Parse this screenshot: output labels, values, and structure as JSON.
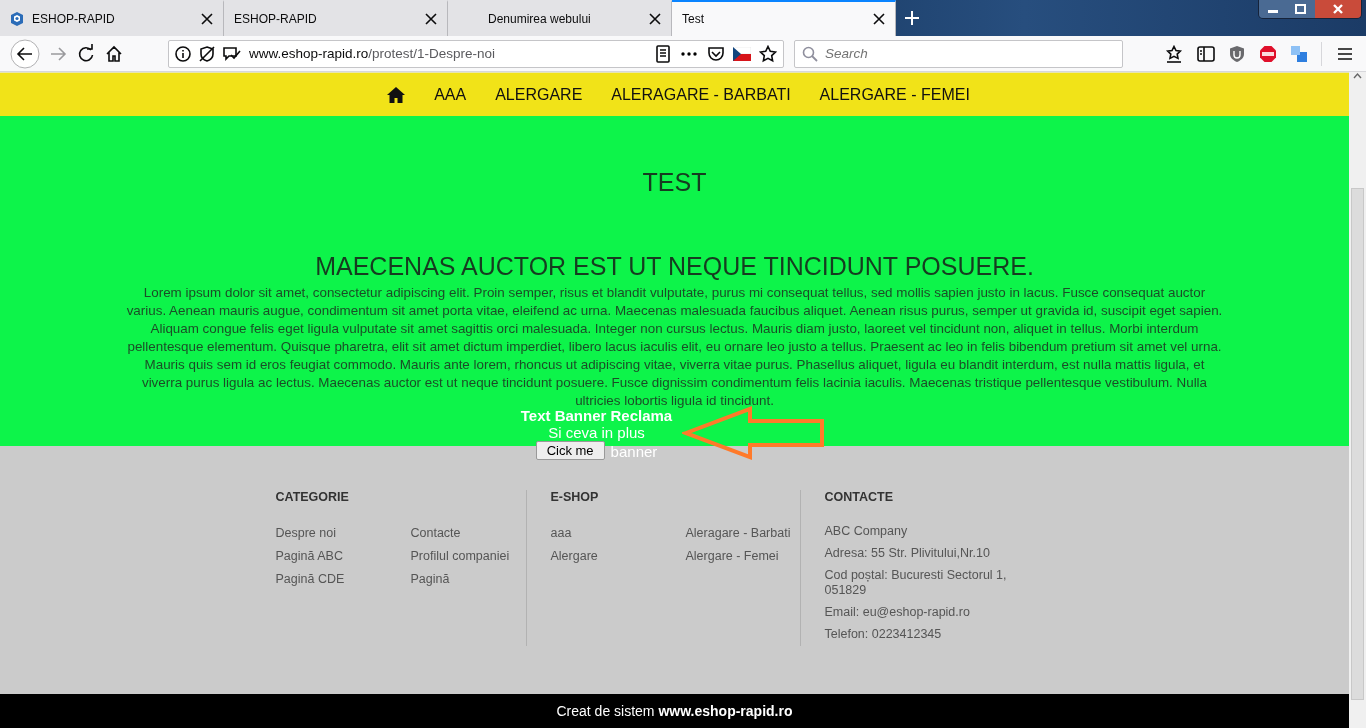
{
  "browser": {
    "tabs": [
      {
        "title": "ESHOP-RAPID",
        "selected": false,
        "favicon": true
      },
      {
        "title": "ESHOP-RAPID",
        "selected": false,
        "favicon": false
      },
      {
        "title": "Denumirea webului",
        "selected": false,
        "favicon": false
      },
      {
        "title": "Test",
        "selected": true,
        "favicon": false
      }
    ],
    "url_host": "www.eshop-rapid.ro",
    "url_path": "/protest/1-Despre-noi",
    "search_placeholder": "Search"
  },
  "nav": {
    "items": [
      "AAA",
      "ALERGARE",
      "ALERAGARE - BARBATI",
      "ALERGARE - FEMEI"
    ]
  },
  "hero": {
    "title": "TEST",
    "heading": "MAECENAS AUCTOR EST UT NEQUE TINCIDUNT POSUERE.",
    "body": "Lorem ipsum dolor sit amet, consectetur adipiscing elit. Proin semper, risus et blandit vulputate, purus mi consequat tellus, sed mollis sapien justo in lacus. Fusce consequat auctor varius. Aenean mauris augue, condimentum sit amet porta vitae, eleifend ac urna. Maecenas malesuada faucibus aliquet. Aenean risus purus, semper ut gravida id, suscipit eget sapien. Aliquam congue felis eget ligula vulputate sit amet sagittis orci malesuada. Integer non cursus lectus. Mauris diam justo, laoreet vel tincidunt non, aliquet in tellus. Morbi interdum pellentesque elementum. Quisque pharetra, elit sit amet dictum imperdiet, libero lacus iaculis elit, eu ornare leo justo a tellus. Praesent ac leo in felis bibendum pretium sit amet vel urna. Mauris quis sem id eros feugiat commodo. Mauris ante lorem, rhoncus ut adipiscing vitae, viverra vitae purus. Phasellus aliquet, ligula eu blandit interdum, est nulla mattis ligula, et viverra purus ligula ac lectus. Maecenas auctor est ut neque tincidunt posuere. Fusce dignissim condimentum felis lacinia iaculis. Maecenas tristique pellentesque vestibulum. Nulla ultricies lobortis ligula id tincidunt.",
    "banner": {
      "title": "Text Banner Reclama",
      "subtitle": "Si ceva in plus",
      "button": "Cick me",
      "caption": "banner"
    }
  },
  "footer": {
    "columns": [
      {
        "heading": "CATEGORIE",
        "kind": "links",
        "items": [
          "Despre noi",
          "Contacte",
          "Pagină ABC",
          "Profilul companiei",
          "Pagină CDE",
          "Pagină"
        ]
      },
      {
        "heading": "E-SHOP",
        "kind": "links",
        "items": [
          "aaa",
          "Aleragare - Barbati",
          "Alergare",
          "Alergare - Femei"
        ]
      },
      {
        "heading": "CONTACTE",
        "kind": "contact",
        "items": [
          "ABC Company",
          "Adresa: 55 Str. Plivitului,Nr.10",
          "Cod poștal: Bucuresti Sectorul 1, 051829",
          "Email: eu@eshop-rapid.ro",
          "Telefon: 0223412345"
        ]
      }
    ]
  },
  "credit": "Creat de sistem **www.eshop-rapid.ro**"
}
